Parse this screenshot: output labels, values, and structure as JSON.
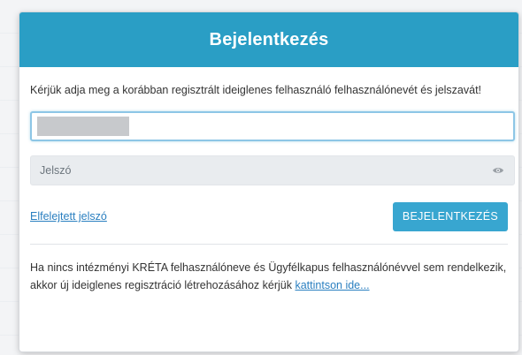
{
  "modal": {
    "title": "Bejelentkezés",
    "instruction": "Kérjük adja meg a korábban regisztrált ideiglenes felhasználó felhasználónevét és jelszavát!",
    "username": {
      "value": "",
      "redacted": true
    },
    "password": {
      "placeholder": "Jelszó",
      "toggle_icon": "eye-icon"
    },
    "forgot_password_link": "Elfelejtett jelszó",
    "login_button": "BEJELENTKEZÉS",
    "footer_text": "Ha nincs intézményi KRÉTA felhasználóneve és Ügyfélkapus felhasználónévvel sem rendelkezik, akkor új ideiglenes regisztráció létrehozásához kérjük",
    "footer_link": "kattintson ide..."
  },
  "colors": {
    "header": "#2a9ec5",
    "button": "#38a6d0",
    "link": "#2a7fc0"
  }
}
